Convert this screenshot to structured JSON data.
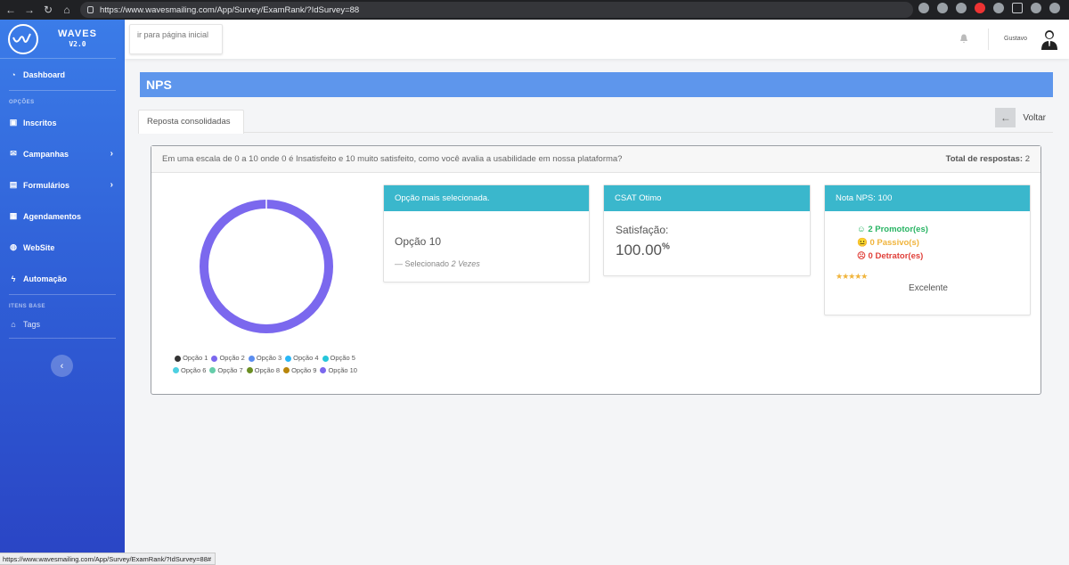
{
  "browser": {
    "url": "https://www.wavesmailing.com/App/Survey/ExamRank/?IdSurvey=88",
    "status_url": "https://www.wavesmailing.com/App/Survey/ExamRank/?IdSurvey=88#"
  },
  "sidebar": {
    "brand": "WAVES",
    "version": "V2.0",
    "dashboard_label": "Dashboard",
    "section_options": "OPÇÕES",
    "items": [
      {
        "label": "Inscritos",
        "icon": "address-book-icon"
      },
      {
        "label": "Campanhas",
        "icon": "envelope-icon"
      },
      {
        "label": "Formulários",
        "icon": "file-icon"
      },
      {
        "label": "Agendamentos",
        "icon": "calendar-icon"
      },
      {
        "label": "WebSite",
        "icon": "globe-icon"
      },
      {
        "label": "Automação",
        "icon": "bolt-icon"
      }
    ],
    "section_base": "ITENS BASE",
    "tags_label": "Tags"
  },
  "topbar": {
    "home_link": "ir para página inicial",
    "username": "Gustavo"
  },
  "page": {
    "title": "NPS",
    "tab_label": "Reposta consolidadas",
    "back_label": "Voltar"
  },
  "survey": {
    "question": "Em uma escala de 0 a 10 onde 0 é Insatisfeito e 10 muito satisfeito, como você avalia a usabilidade em nossa plataforma?",
    "total_label": "Total de respostas:",
    "total_value": "2"
  },
  "chart_data": {
    "type": "pie",
    "categories": [
      "Opção 1",
      "Opção 2",
      "Opção 3",
      "Opção 4",
      "Opção 5",
      "Opção 6",
      "Opção 7",
      "Opção 8",
      "Opção 9",
      "Opção 10"
    ],
    "values": [
      0,
      0,
      0,
      0,
      0,
      0,
      0,
      0,
      0,
      2
    ],
    "colors": [
      "#333333",
      "#7b68ee",
      "#5b8def",
      "#29b6f6",
      "#26c6da",
      "#4dd0e1",
      "#66cdaa",
      "#6b8e23",
      "#b8860b",
      "#7b68ee"
    ],
    "legend": "bottom"
  },
  "stats": {
    "most_selected": {
      "header": "Opção mais selecionada.",
      "option": "Opção 10",
      "prefix": "— Selecionado",
      "times": "2 Vezes"
    },
    "csat": {
      "header": "CSAT Otimo",
      "label": "Satisfação:",
      "value": "100.00",
      "unit": "%"
    },
    "nps": {
      "header": "Nota NPS: 100",
      "promotores": "☺ 2 Promotor(es)",
      "passivos": "😐 0 Passivo(s)",
      "detratores": "☹ 0 Detrator(es)",
      "stars": "★★★★★",
      "rating": "Excelente"
    }
  },
  "colors": {
    "sidebar_top": "#3b7ce8",
    "sidebar_bottom": "#2a44c4",
    "banner": "#5e96ec",
    "box_header": "#3ab7cc"
  }
}
